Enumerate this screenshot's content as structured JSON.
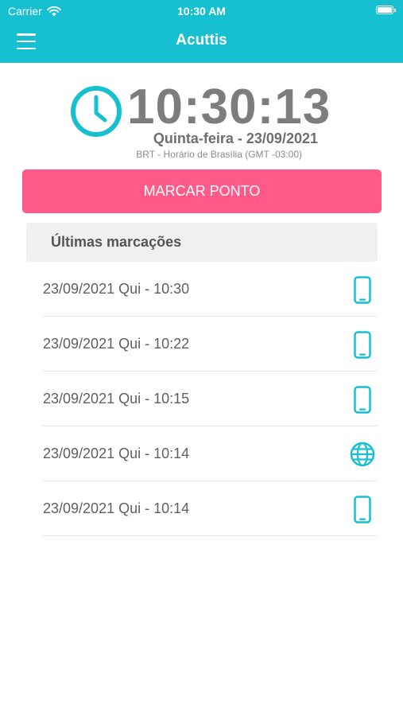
{
  "status_bar": {
    "carrier": "Carrier",
    "time": "10:30 AM"
  },
  "header": {
    "title": "Acuttis"
  },
  "clock": {
    "time": "10:30:13",
    "date": "Quinta-feira - 23/09/2021",
    "timezone": "BRT - Horário de Brasília (GMT -03:00)"
  },
  "actions": {
    "mark_label": "MARCAR PONTO"
  },
  "section": {
    "title": "Últimas marcações"
  },
  "entries": [
    {
      "text": "23/09/2021 Qui - 10:30",
      "icon": "phone-icon"
    },
    {
      "text": "23/09/2021 Qui - 10:22",
      "icon": "phone-icon"
    },
    {
      "text": "23/09/2021 Qui - 10:15",
      "icon": "phone-icon"
    },
    {
      "text": "23/09/2021 Qui - 10:14",
      "icon": "globe-icon"
    },
    {
      "text": "23/09/2021 Qui - 10:14",
      "icon": "phone-icon"
    }
  ],
  "colors": {
    "primary": "#16c0d0",
    "accent": "#ff5a8a",
    "clock_text": "#7d7d7d"
  }
}
